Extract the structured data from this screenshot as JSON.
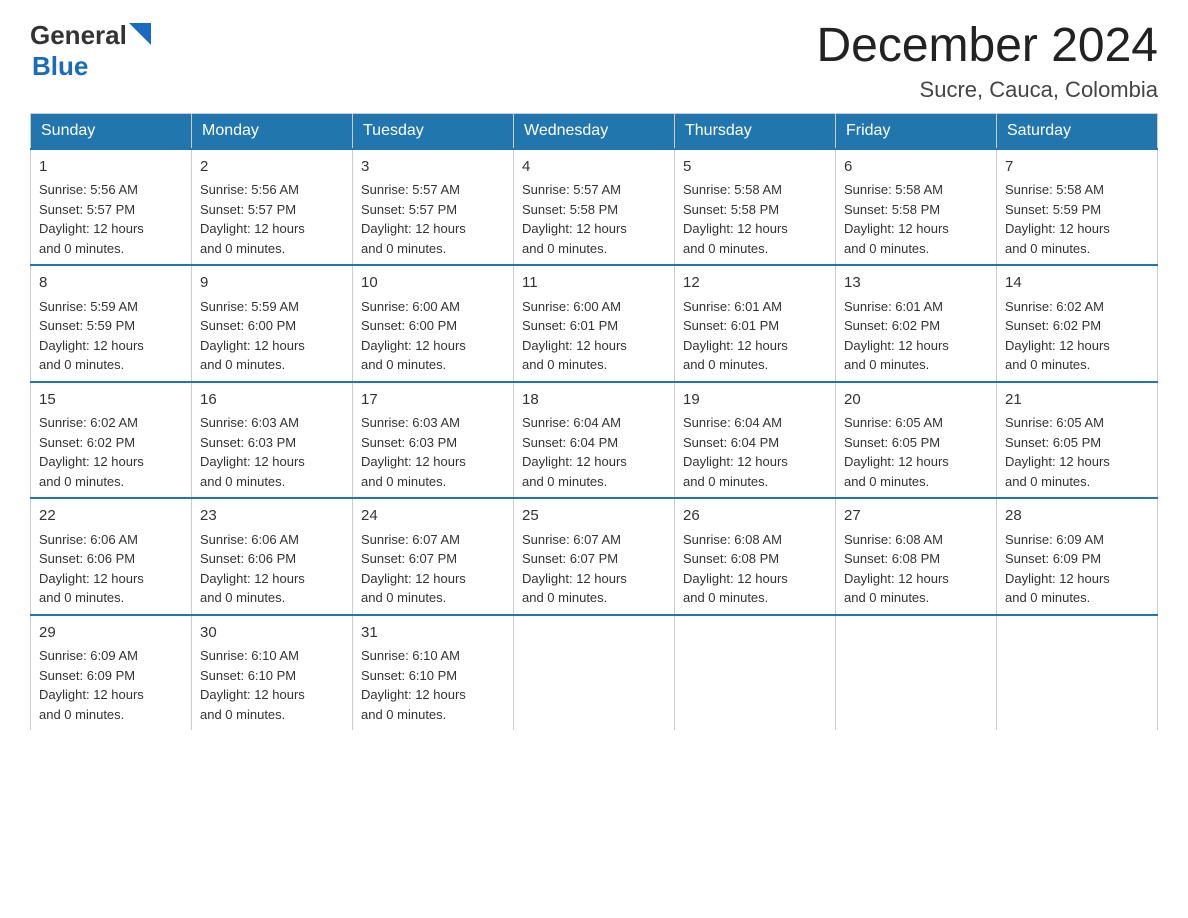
{
  "header": {
    "logo": {
      "text_general": "General",
      "text_blue": "Blue"
    },
    "month_title": "December 2024",
    "location": "Sucre, Cauca, Colombia"
  },
  "days_of_week": [
    "Sunday",
    "Monday",
    "Tuesday",
    "Wednesday",
    "Thursday",
    "Friday",
    "Saturday"
  ],
  "weeks": [
    [
      {
        "day": "1",
        "sunrise": "5:56 AM",
        "sunset": "5:57 PM",
        "daylight": "12 hours and 0 minutes."
      },
      {
        "day": "2",
        "sunrise": "5:56 AM",
        "sunset": "5:57 PM",
        "daylight": "12 hours and 0 minutes."
      },
      {
        "day": "3",
        "sunrise": "5:57 AM",
        "sunset": "5:57 PM",
        "daylight": "12 hours and 0 minutes."
      },
      {
        "day": "4",
        "sunrise": "5:57 AM",
        "sunset": "5:58 PM",
        "daylight": "12 hours and 0 minutes."
      },
      {
        "day": "5",
        "sunrise": "5:58 AM",
        "sunset": "5:58 PM",
        "daylight": "12 hours and 0 minutes."
      },
      {
        "day": "6",
        "sunrise": "5:58 AM",
        "sunset": "5:58 PM",
        "daylight": "12 hours and 0 minutes."
      },
      {
        "day": "7",
        "sunrise": "5:58 AM",
        "sunset": "5:59 PM",
        "daylight": "12 hours and 0 minutes."
      }
    ],
    [
      {
        "day": "8",
        "sunrise": "5:59 AM",
        "sunset": "5:59 PM",
        "daylight": "12 hours and 0 minutes."
      },
      {
        "day": "9",
        "sunrise": "5:59 AM",
        "sunset": "6:00 PM",
        "daylight": "12 hours and 0 minutes."
      },
      {
        "day": "10",
        "sunrise": "6:00 AM",
        "sunset": "6:00 PM",
        "daylight": "12 hours and 0 minutes."
      },
      {
        "day": "11",
        "sunrise": "6:00 AM",
        "sunset": "6:01 PM",
        "daylight": "12 hours and 0 minutes."
      },
      {
        "day": "12",
        "sunrise": "6:01 AM",
        "sunset": "6:01 PM",
        "daylight": "12 hours and 0 minutes."
      },
      {
        "day": "13",
        "sunrise": "6:01 AM",
        "sunset": "6:02 PM",
        "daylight": "12 hours and 0 minutes."
      },
      {
        "day": "14",
        "sunrise": "6:02 AM",
        "sunset": "6:02 PM",
        "daylight": "12 hours and 0 minutes."
      }
    ],
    [
      {
        "day": "15",
        "sunrise": "6:02 AM",
        "sunset": "6:02 PM",
        "daylight": "12 hours and 0 minutes."
      },
      {
        "day": "16",
        "sunrise": "6:03 AM",
        "sunset": "6:03 PM",
        "daylight": "12 hours and 0 minutes."
      },
      {
        "day": "17",
        "sunrise": "6:03 AM",
        "sunset": "6:03 PM",
        "daylight": "12 hours and 0 minutes."
      },
      {
        "day": "18",
        "sunrise": "6:04 AM",
        "sunset": "6:04 PM",
        "daylight": "12 hours and 0 minutes."
      },
      {
        "day": "19",
        "sunrise": "6:04 AM",
        "sunset": "6:04 PM",
        "daylight": "12 hours and 0 minutes."
      },
      {
        "day": "20",
        "sunrise": "6:05 AM",
        "sunset": "6:05 PM",
        "daylight": "12 hours and 0 minutes."
      },
      {
        "day": "21",
        "sunrise": "6:05 AM",
        "sunset": "6:05 PM",
        "daylight": "12 hours and 0 minutes."
      }
    ],
    [
      {
        "day": "22",
        "sunrise": "6:06 AM",
        "sunset": "6:06 PM",
        "daylight": "12 hours and 0 minutes."
      },
      {
        "day": "23",
        "sunrise": "6:06 AM",
        "sunset": "6:06 PM",
        "daylight": "12 hours and 0 minutes."
      },
      {
        "day": "24",
        "sunrise": "6:07 AM",
        "sunset": "6:07 PM",
        "daylight": "12 hours and 0 minutes."
      },
      {
        "day": "25",
        "sunrise": "6:07 AM",
        "sunset": "6:07 PM",
        "daylight": "12 hours and 0 minutes."
      },
      {
        "day": "26",
        "sunrise": "6:08 AM",
        "sunset": "6:08 PM",
        "daylight": "12 hours and 0 minutes."
      },
      {
        "day": "27",
        "sunrise": "6:08 AM",
        "sunset": "6:08 PM",
        "daylight": "12 hours and 0 minutes."
      },
      {
        "day": "28",
        "sunrise": "6:09 AM",
        "sunset": "6:09 PM",
        "daylight": "12 hours and 0 minutes."
      }
    ],
    [
      {
        "day": "29",
        "sunrise": "6:09 AM",
        "sunset": "6:09 PM",
        "daylight": "12 hours and 0 minutes."
      },
      {
        "day": "30",
        "sunrise": "6:10 AM",
        "sunset": "6:10 PM",
        "daylight": "12 hours and 0 minutes."
      },
      {
        "day": "31",
        "sunrise": "6:10 AM",
        "sunset": "6:10 PM",
        "daylight": "12 hours and 0 minutes."
      },
      null,
      null,
      null,
      null
    ]
  ],
  "labels": {
    "sunrise": "Sunrise:",
    "sunset": "Sunset:",
    "daylight": "Daylight:"
  }
}
